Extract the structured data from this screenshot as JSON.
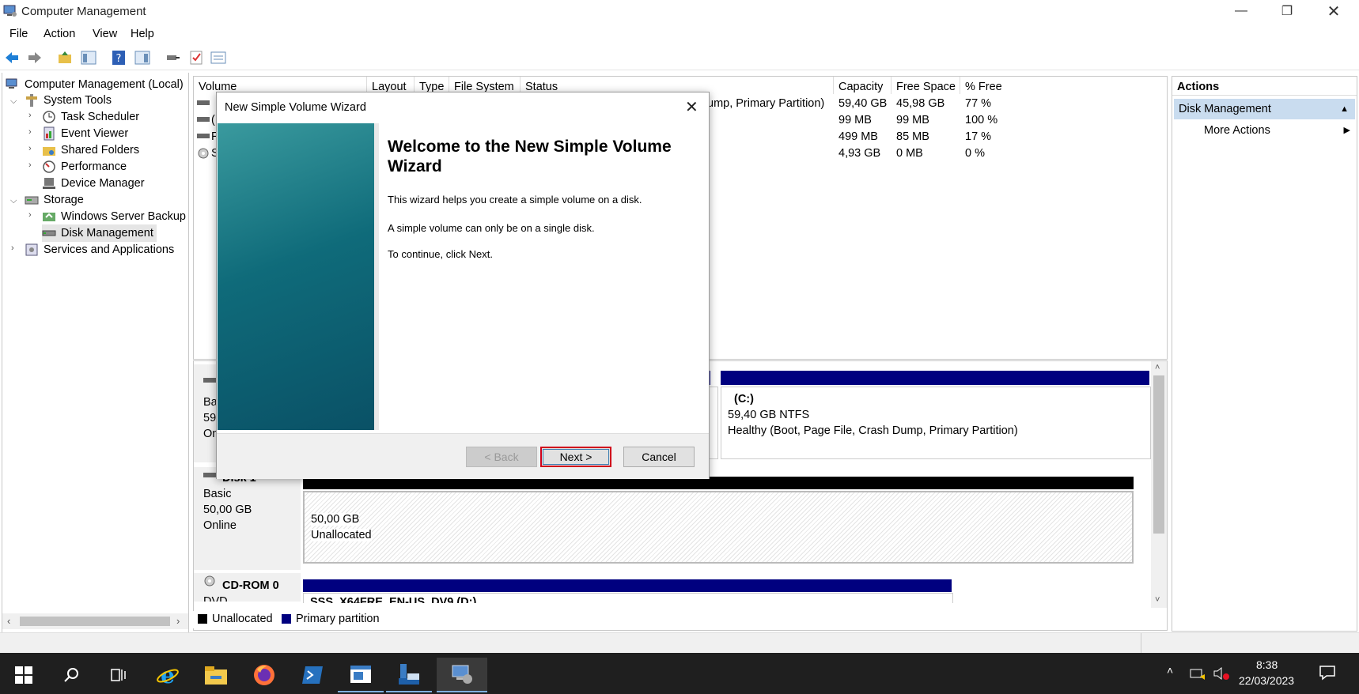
{
  "window": {
    "title": "Computer Management",
    "menu": [
      "File",
      "Action",
      "View",
      "Help"
    ]
  },
  "tree": {
    "root": "Computer Management (Local)",
    "system_tools": "System Tools",
    "task_scheduler": "Task Scheduler",
    "event_viewer": "Event Viewer",
    "shared_folders": "Shared Folders",
    "performance": "Performance",
    "device_manager": "Device Manager",
    "storage": "Storage",
    "windows_server_backup": "Windows Server Backup",
    "disk_management": "Disk Management",
    "services_apps": "Services and Applications"
  },
  "volume_list": {
    "columns": [
      "Volume",
      "Layout",
      "Type",
      "File System",
      "Status",
      "Capacity",
      "Free Space",
      "% Free"
    ],
    "rows": [
      {
        "volume_frag": "",
        "status_frag": "ump, Primary Partition)",
        "capacity": "59,40 GB",
        "free": "45,98 GB",
        "pct": "77 %"
      },
      {
        "volume_frag": "(",
        "status_frag": "",
        "capacity": "99 MB",
        "free": "99 MB",
        "pct": "100 %"
      },
      {
        "volume_frag": "F",
        "status_frag": "",
        "capacity": "499 MB",
        "free": "85 MB",
        "pct": "17 %"
      },
      {
        "volume_frag": "S",
        "status_frag": "",
        "capacity": "4,93 GB",
        "free": "0 MB",
        "pct": "0 %"
      }
    ]
  },
  "disk_map": {
    "disk0": {
      "type_frag": "Bas",
      "size_frag": "59,",
      "status_frag": "On"
    },
    "c_partition": {
      "name": "(C:)",
      "size": "59,40 GB NTFS",
      "status": "Healthy (Boot, Page File, Crash Dump, Primary Partition)"
    },
    "disk1": {
      "name": "Disk 1",
      "type": "Basic",
      "size": "50,00 GB",
      "status": "Online",
      "part_size": "50,00 GB",
      "part_label": "Unallocated"
    },
    "cdrom": {
      "name": "CD-ROM 0",
      "type": "DVD",
      "media": "SSS_X64FRE_EN-US_DV9  (D:)"
    }
  },
  "legend": {
    "unallocated": "Unallocated",
    "primary": "Primary partition",
    "unallocated_color": "#000000",
    "primary_color": "#00007f"
  },
  "actions": {
    "header": "Actions",
    "section": "Disk Management",
    "more": "More Actions"
  },
  "dialog": {
    "title": "New Simple Volume Wizard",
    "heading": "Welcome to the New Simple Volume Wizard",
    "line1": "This wizard helps you create a simple volume on a disk.",
    "line2": "A simple volume can only be on a single disk.",
    "line3": "To continue, click Next.",
    "back": "< Back",
    "next": "Next >",
    "cancel": "Cancel"
  },
  "taskbar": {
    "time": "8:38",
    "date": "22/03/2023"
  }
}
